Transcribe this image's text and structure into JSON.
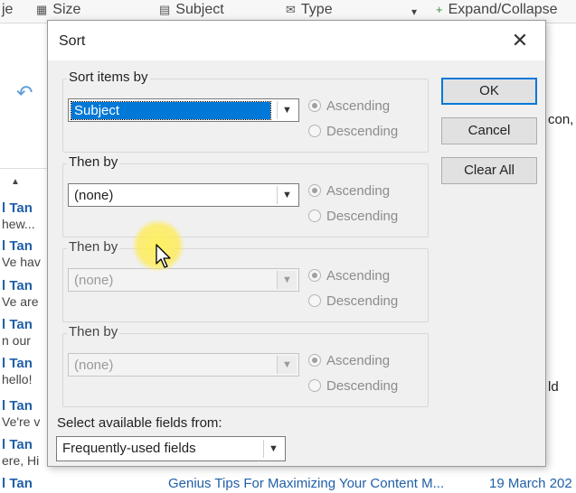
{
  "background": {
    "toolbar": {
      "partial_left": "je",
      "size_label": "Size",
      "subject_label": "Subject",
      "type_label": "Type",
      "expand_label": "Expand/Collapse"
    },
    "senders": [
      {
        "name": "l Tan",
        "snippet": "hew..."
      },
      {
        "name": "l Tan",
        "snippet": "Ve hav"
      },
      {
        "name": "l Tan",
        "snippet": "Ve are"
      },
      {
        "name": "l Tan",
        "snippet": "n our"
      },
      {
        "name": "l Tan",
        "snippet": "hello!"
      },
      {
        "name": "l Tan",
        "snippet": "Ve're v"
      },
      {
        "name": "l Tan",
        "snippet": "ere, Hi"
      },
      {
        "name": "l Tan",
        "snippet": ""
      }
    ],
    "right_text_1": "con,",
    "right_text_2": "ld",
    "bottom_subject": "Genius Tips For Maximizing Your Content M...",
    "bottom_date": "19 March 202"
  },
  "dialog": {
    "title": "Sort",
    "groups": [
      {
        "label": "Sort items by",
        "value": "Subject",
        "enabled": true,
        "selected": true
      },
      {
        "label": "Then by",
        "value": "(none)",
        "enabled": true,
        "selected": false
      },
      {
        "label": "Then by",
        "value": "(none)",
        "enabled": false,
        "selected": false
      },
      {
        "label": "Then by",
        "value": "(none)",
        "enabled": false,
        "selected": false
      }
    ],
    "ascending_label": "Ascending",
    "descending_label": "Descending",
    "buttons": {
      "ok": "OK",
      "cancel": "Cancel",
      "clear_all": "Clear All"
    },
    "available_fields_label": "Select available fields from:",
    "available_fields_value": "Frequently-used fields"
  },
  "colors": {
    "selection": "#0078d7",
    "link": "#1f5fa8",
    "cursor_highlight": "#fff05a"
  }
}
